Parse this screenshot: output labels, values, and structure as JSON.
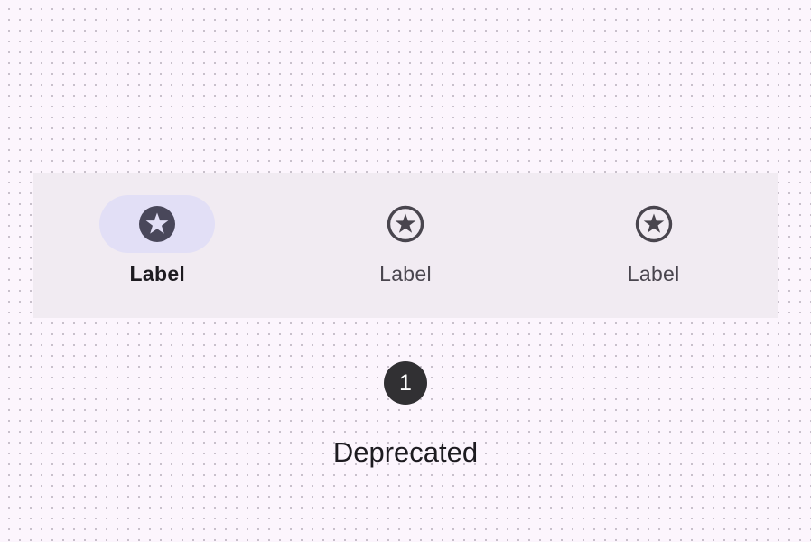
{
  "navigation_bar": {
    "items": [
      {
        "label": "Label",
        "icon": "star-circle-icon",
        "active": true
      },
      {
        "label": "Label",
        "icon": "star-circle-icon",
        "active": false
      },
      {
        "label": "Label",
        "icon": "star-circle-icon",
        "active": false
      }
    ]
  },
  "annotation": {
    "badge_number": "1",
    "caption": "Deprecated"
  },
  "colors": {
    "background": "#fcf5fd",
    "nav_bar_surface": "#f1ebf2",
    "active_indicator": "#e2dff6",
    "icon_active": "#49475a",
    "icon_inactive": "#49454e",
    "badge": "#313033"
  }
}
